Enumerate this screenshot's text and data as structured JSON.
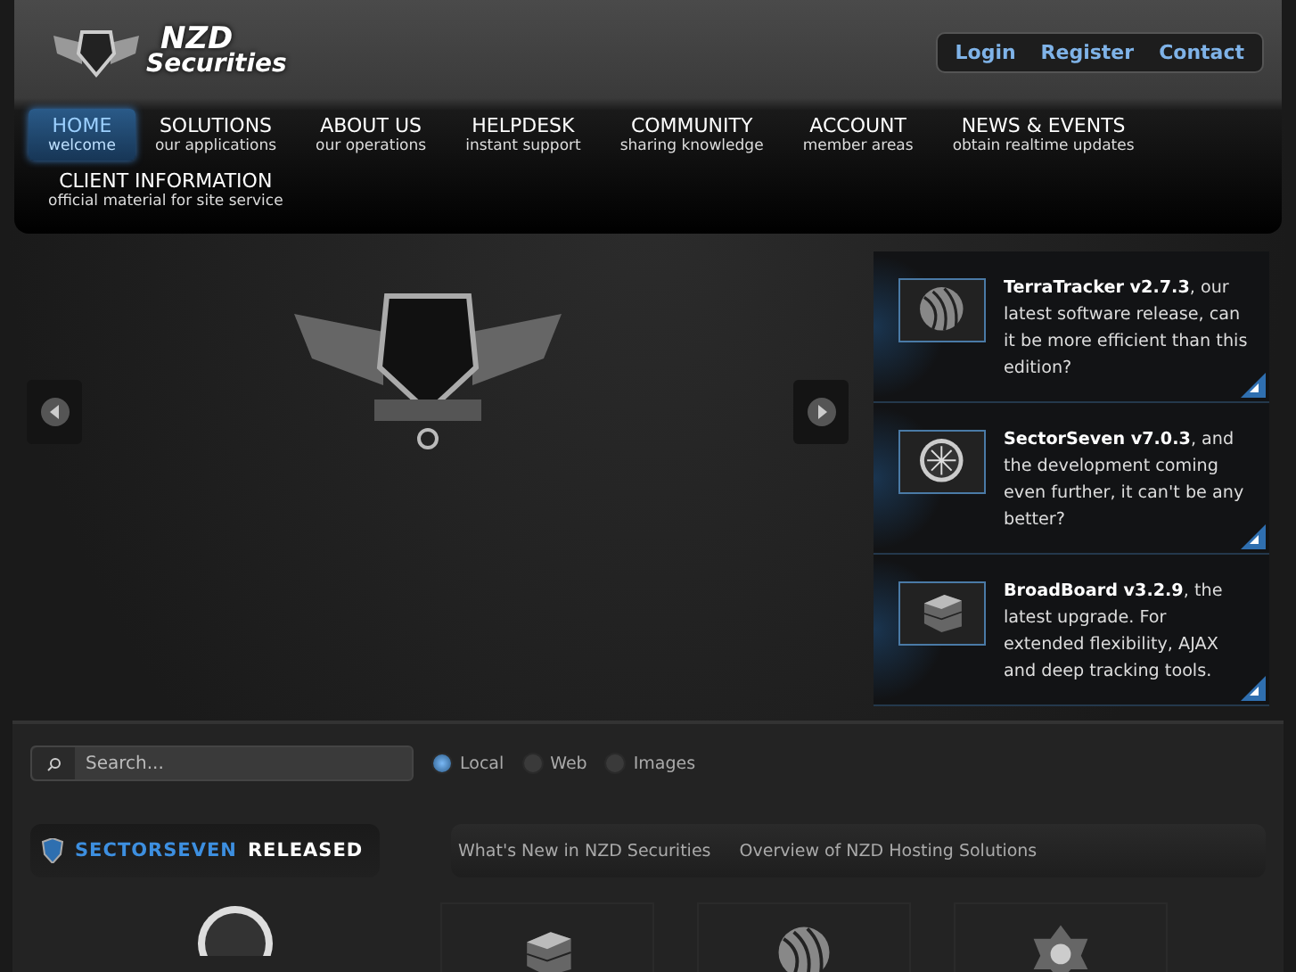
{
  "logo": {
    "line1": "NZD",
    "line2": "Securities"
  },
  "top_links": [
    {
      "label": "Login"
    },
    {
      "label": "Register"
    },
    {
      "label": "Contact"
    }
  ],
  "nav": [
    {
      "label": "HOME",
      "sub": "welcome",
      "selected": true
    },
    {
      "label": "SOLUTIONS",
      "sub": "our applications",
      "selected": false
    },
    {
      "label": "ABOUT US",
      "sub": "our operations",
      "selected": false
    },
    {
      "label": "HELPDESK",
      "sub": "instant support",
      "selected": false
    },
    {
      "label": "COMMUNITY",
      "sub": "sharing knowledge",
      "selected": false
    },
    {
      "label": "ACCOUNT",
      "sub": "member areas",
      "selected": false
    },
    {
      "label": "NEWS & EVENTS",
      "sub": "obtain realtime updates",
      "selected": false
    },
    {
      "label": "CLIENT INFORMATION",
      "sub": "official material for site service",
      "selected": false
    }
  ],
  "features": [
    {
      "kind": "globe",
      "text": "**TerraTracker v2.7.3**, our latest software release, can it be more efficient than this edition?"
    },
    {
      "kind": "dial",
      "text": "**SectorSeven v7.0.3**, and the development coming even further, it can't be any better?"
    },
    {
      "kind": "boxes",
      "text": "**BroadBoard v3.2.9**, the latest upgrade. For extended flexibility, AJAX and deep tracking tools."
    }
  ],
  "search": {
    "placeholder": "Search..."
  },
  "scopes": [
    {
      "label": "Local",
      "selected": true
    },
    {
      "label": "Web",
      "selected": false
    },
    {
      "label": "Images",
      "selected": false
    }
  ],
  "release": {
    "highlight": "SECTORSEVEN",
    "rest": "RELEASED"
  },
  "tabs": [
    {
      "label": "What's New in NZD Securities"
    },
    {
      "label": "Overview of NZD Hosting Solutions"
    }
  ],
  "products": [
    {
      "kind": "boxes"
    },
    {
      "kind": "globe"
    },
    {
      "kind": "flower"
    }
  ]
}
